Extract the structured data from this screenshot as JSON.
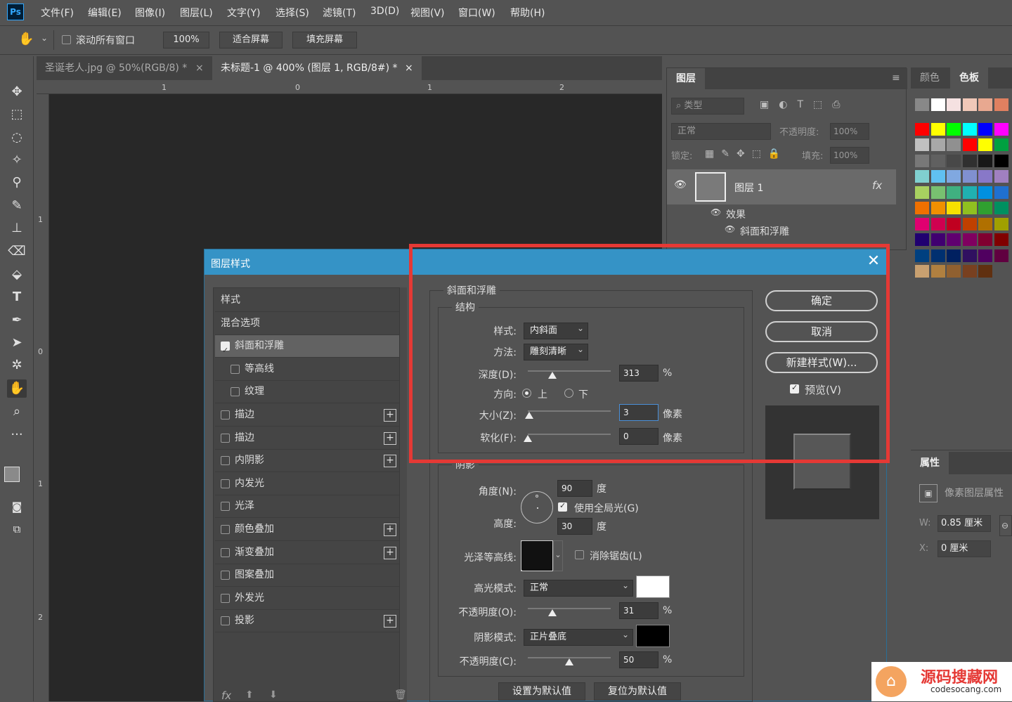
{
  "app": {
    "logo": "Ps"
  },
  "menu": [
    "文件(F)",
    "编辑(E)",
    "图像(I)",
    "图层(L)",
    "文字(Y)",
    "选择(S)",
    "滤镜(T)",
    "3D(D)",
    "视图(V)",
    "窗口(W)",
    "帮助(H)"
  ],
  "options": {
    "scroll_all": "滚动所有窗口",
    "zoom": "100%",
    "fit_screen": "适合屏幕",
    "fill_screen": "填充屏幕"
  },
  "tabs": [
    {
      "label": "圣诞老人.jpg @ 50%(RGB/8) *",
      "close": "×"
    },
    {
      "label": "未标题-1 @ 400% (图层 1, RGB/8#) *",
      "close": "×"
    }
  ],
  "ruler": {
    "top": [
      "1",
      "0",
      "1",
      "2"
    ],
    "left": [
      "1",
      "0",
      "1",
      "2"
    ]
  },
  "layers": {
    "tab": "图层",
    "search_placeholder": "类型",
    "blend": "正常",
    "opacity_label": "不透明度:",
    "opacity": "100%",
    "lock_label": "锁定:",
    "fill_label": "填充:",
    "fill": "100%",
    "layer_name": "图层 1",
    "fx": "fx",
    "effects": "效果",
    "effect_item": "斜面和浮雕"
  },
  "swatches": {
    "tab_color": "颜色",
    "tab_swatch": "色板",
    "colors": [
      "#888888",
      "#ffffff",
      "#f5e1e1",
      "#f0c8b8",
      "#e8a890",
      "#e08060",
      "#ff0000",
      "#ffff00",
      "#00ff00",
      "#00ffff",
      "#0000ff",
      "#ff00ff",
      "#c0c0c0",
      "#a8a8a8",
      "#909090",
      "#ff0000",
      "#ffff00",
      "#00a040",
      "#787878",
      "#606060",
      "#484848",
      "#303030",
      "#181818",
      "#000000",
      "#80d0d0",
      "#60c0f0",
      "#80a8e0",
      "#8090d0",
      "#8878c8",
      "#a080c0",
      "#a8d060",
      "#78c070",
      "#40b080",
      "#20b0b0",
      "#0090e0",
      "#2070d0",
      "#f07000",
      "#f09000",
      "#f8e000",
      "#90c020",
      "#30a030",
      "#009060",
      "#e00070",
      "#d00050",
      "#c00020",
      "#c04000",
      "#b07000",
      "#a0a000",
      "#200070",
      "#400070",
      "#600070",
      "#800060",
      "#800030",
      "#800000",
      "#004080",
      "#003070",
      "#002060",
      "#301060",
      "#500060",
      "#600040",
      "#c8a070",
      "#b08040",
      "#906030",
      "#784020",
      "#603010"
    ]
  },
  "props": {
    "tab": "属性",
    "title": "像素图层属性",
    "w_label": "W:",
    "w": "0.85 厘米",
    "x_label": "X:",
    "x": "0 厘米"
  },
  "dialog": {
    "title": "图层样式",
    "close": "✕",
    "styles": [
      {
        "label": "样式",
        "cb": false,
        "plus": false,
        "noCb": true
      },
      {
        "label": "混合选项",
        "cb": false,
        "plus": false,
        "noCb": true
      },
      {
        "label": "斜面和浮雕",
        "cb": true,
        "plus": false,
        "active": true
      },
      {
        "label": "等高线",
        "cb": false,
        "plus": false,
        "sub": true
      },
      {
        "label": "纹理",
        "cb": false,
        "plus": false,
        "sub": true
      },
      {
        "label": "描边",
        "cb": false,
        "plus": true
      },
      {
        "label": "描边",
        "cb": false,
        "plus": true
      },
      {
        "label": "内阴影",
        "cb": false,
        "plus": true
      },
      {
        "label": "内发光",
        "cb": false,
        "plus": false
      },
      {
        "label": "光泽",
        "cb": false,
        "plus": false
      },
      {
        "label": "颜色叠加",
        "cb": false,
        "plus": true
      },
      {
        "label": "渐变叠加",
        "cb": false,
        "plus": true
      },
      {
        "label": "图案叠加",
        "cb": false,
        "plus": false
      },
      {
        "label": "外发光",
        "cb": false,
        "plus": false
      },
      {
        "label": "投影",
        "cb": false,
        "plus": true
      }
    ],
    "fx": "fx",
    "bevel": {
      "legend": "斜面和浮雕",
      "structure": "结构",
      "style_label": "样式:",
      "style": "内斜面",
      "technique_label": "方法:",
      "technique": "雕刻清晰",
      "depth_label": "深度(D):",
      "depth": "313",
      "pct": "%",
      "depth_level": 0.3,
      "direction_label": "方向:",
      "up": "上",
      "down": "下",
      "size_label": "大小(Z):",
      "size": "3",
      "px": "像素",
      "size_level": 0.02,
      "soften_label": "软化(F):",
      "soften": "0",
      "soften_level": 0
    },
    "shading": {
      "legend": "阴影",
      "angle_label": "角度(N):",
      "angle": "90",
      "deg": "度",
      "global_light": "使用全局光(G)",
      "altitude_label": "高度:",
      "altitude": "30",
      "gloss_label": "光泽等高线:",
      "antialias": "消除锯齿(L)",
      "highlight_label": "高光模式:",
      "highlight_mode": "正常",
      "highlight_color": "#ffffff",
      "opacity_o_label": "不透明度(O):",
      "opacity_o": "31",
      "opacity_o_level": 0.3,
      "shadow_label": "阴影模式:",
      "shadow_mode": "正片叠底",
      "shadow_color": "#000000",
      "opacity_c_label": "不透明度(C):",
      "opacity_c": "50",
      "opacity_c_level": 0.5
    },
    "set_default": "设置为默认值",
    "reset_default": "复位为默认值",
    "ok": "确定",
    "cancel": "取消",
    "new_style": "新建样式(W)...",
    "preview": "预览(V)"
  },
  "watermark": {
    "title": "源码搜藏网",
    "url": "codesocang.com"
  }
}
